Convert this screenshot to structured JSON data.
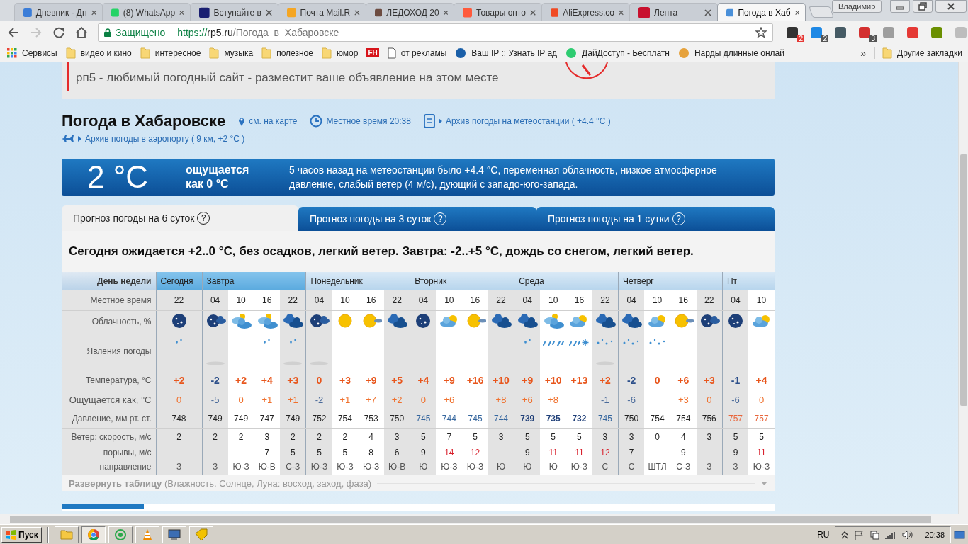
{
  "browser": {
    "tabs": [
      {
        "title": "Дневник - Дн",
        "color": "#3b7dd8",
        "selected": false
      },
      {
        "title": "(8) WhatsApp",
        "color": "#25d366",
        "selected": false
      },
      {
        "title": "Вступайте в",
        "color": "#1a1f71",
        "selected": false
      },
      {
        "title": "Почта Mail.R",
        "color": "#f5a623",
        "selected": false
      },
      {
        "title": "ЛЕДОХОД 20",
        "color": "#6d4c41",
        "selected": false
      },
      {
        "title": "Товары опто",
        "color": "#ff5a3c",
        "selected": false
      },
      {
        "title": "AliExpress.co",
        "color": "#f04a23",
        "selected": false
      },
      {
        "title": "Лента",
        "color": "#c8102e",
        "selected": false
      },
      {
        "title": "Погода в Хаб",
        "color": "#4a90d9",
        "selected": true
      }
    ],
    "profile": "Владимир",
    "forward_disabled": true,
    "secure_label": "Защищено",
    "url": {
      "scheme": "https://",
      "host": "rp5.ru",
      "path": "/Погода_в_Хабаровске"
    },
    "extensions": [
      {
        "color": "#333333",
        "badge": "2"
      },
      {
        "color": "#1e88e5",
        "badge": "2"
      },
      {
        "color": "#455a64"
      },
      {
        "color": "#d32f2f",
        "badge": "3"
      },
      {
        "color": "#9e9e9e"
      },
      {
        "color": "#e53935"
      },
      {
        "color": "#6a8f00"
      },
      {
        "color": "#bdbdbd"
      }
    ],
    "bookmarks": [
      {
        "kind": "apps",
        "label": "Сервисы"
      },
      {
        "kind": "folder",
        "label": "видео и кино"
      },
      {
        "kind": "folder",
        "label": "интересное"
      },
      {
        "kind": "folder",
        "label": "музыка"
      },
      {
        "kind": "folder",
        "label": "полезное"
      },
      {
        "kind": "folder",
        "label": "юмор"
      },
      {
        "kind": "logo",
        "logo": "FH"
      },
      {
        "kind": "page",
        "label": "от рекламы"
      },
      {
        "kind": "site",
        "label": "Ваш IP :: Узнать IP ад",
        "color": "#1a5fa8"
      },
      {
        "kind": "site",
        "label": "ДайДоступ - Бесплатн",
        "color": "#2ecc71"
      },
      {
        "kind": "site",
        "label": "Нарды длинные онлай",
        "color": "#e6a23c"
      }
    ],
    "more": "»",
    "other_bookmarks": "Другие закладки"
  },
  "page": {
    "ad": "рп5 - любимый погодный сайт - разместит ваше объявление на этом месте",
    "title": "Погода в Хабаровске",
    "map_link": "см. на карте",
    "local_time": "Местное время  20:38",
    "archive_station": "Архив погоды на метеостанции ( +4.4 °C )",
    "archive_airport": "Архив погоды в аэропорту ( 9 км, +2 °C )",
    "current": {
      "temperature": "2 °C",
      "feels": "ощущается как 0 °C",
      "description": "5 часов назад на метеостанции было +4.4 °C, переменная облачность, низкое атмосферное давление, слабый ветер (4 м/с), дующий с западо-юго-запада."
    },
    "forecast_tabs": [
      {
        "label": "Прогноз погоды на 6 суток",
        "help": "?",
        "selected": true
      },
      {
        "label": "Прогноз погоды на 3 суток",
        "help": "?",
        "selected": false
      },
      {
        "label": "Прогноз погоды на 1 сутки",
        "help": "?",
        "selected": false
      }
    ],
    "summary": "Сегодня ожидается +2..0 °C, без осадков, легкий ветер. Завтра: -2..+5 °C, дождь со снегом, легкий ветер.",
    "table": {
      "row_labels": [
        "День недели",
        "Местное время",
        "Облачность, %",
        "Явления погоды",
        "Температура, °C",
        "Ощущается как, °C",
        "Давление, мм рт. ст.",
        "Ветер: скорость, м/с",
        "порывы, м/с",
        "направление"
      ],
      "days": [
        {
          "name": "Сегодня",
          "highlight": true,
          "columns": [
            {
              "time": "22",
              "night": true,
              "sky": {
                "kind": "night-clear"
              },
              "precip": {
                "kind": "drizzle"
              },
              "fog": false,
              "temp": {
                "value": "+2",
                "kind": "warm"
              },
              "feels": {
                "value": "0",
                "kind": "warm"
              },
              "pressure": {
                "value": "748",
                "kind": "normal"
              },
              "wind": "2",
              "dir": "З"
            }
          ]
        },
        {
          "name": "Завтра",
          "highlight": true,
          "columns": [
            {
              "time": "04",
              "night": true,
              "sky": {
                "kind": "night-partly"
              },
              "fog": true,
              "temp": {
                "value": "-2",
                "kind": "cold"
              },
              "feels": {
                "value": "-5",
                "kind": "cold"
              },
              "pressure": {
                "value": "749",
                "kind": "normal"
              },
              "wind": "2",
              "dir": "З"
            },
            {
              "time": "10",
              "night": false,
              "sky": {
                "kind": "cloudy-sun"
              },
              "fog": false,
              "temp": {
                "value": "+2",
                "kind": "warm"
              },
              "feels": {
                "value": "0",
                "kind": "warm"
              },
              "pressure": {
                "value": "749",
                "kind": "normal"
              },
              "wind": "2",
              "dir": "Ю-З"
            },
            {
              "time": "16",
              "night": false,
              "sky": {
                "kind": "cloudy-sun"
              },
              "precip": {
                "kind": "drizzle"
              },
              "fog": false,
              "temp": {
                "value": "+4",
                "kind": "warm"
              },
              "feels": {
                "value": "+1",
                "kind": "warm"
              },
              "pressure": {
                "value": "747",
                "kind": "normal"
              },
              "wind": "3",
              "gust": {
                "value": "7",
                "strong": false
              },
              "dir": "Ю-В"
            },
            {
              "time": "22",
              "night": true,
              "sky": {
                "kind": "overcast"
              },
              "precip": {
                "kind": "drizzle"
              },
              "fog": true,
              "temp": {
                "value": "+3",
                "kind": "warm"
              },
              "feels": {
                "value": "+1",
                "kind": "warm"
              },
              "pressure": {
                "value": "749",
                "kind": "normal"
              },
              "wind": "2",
              "gust": {
                "value": "5",
                "strong": false
              },
              "dir": "С-З"
            }
          ]
        },
        {
          "name": "Понедельник",
          "highlight": false,
          "columns": [
            {
              "time": "04",
              "night": true,
              "sky": {
                "kind": "night-partly"
              },
              "fog": true,
              "temp": {
                "value": "0",
                "kind": "warm"
              },
              "feels": {
                "value": "-2",
                "kind": "cold"
              },
              "pressure": {
                "value": "752",
                "kind": "normal"
              },
              "wind": "2",
              "gust": {
                "value": "5",
                "strong": false
              },
              "dir": "Ю-З"
            },
            {
              "time": "10",
              "night": false,
              "sky": {
                "kind": "sun"
              },
              "fog": false,
              "temp": {
                "value": "+3",
                "kind": "warm"
              },
              "feels": {
                "value": "+1",
                "kind": "warm"
              },
              "pressure": {
                "value": "754",
                "kind": "normal"
              },
              "wind": "2",
              "gust": {
                "value": "5",
                "strong": false
              },
              "dir": "Ю-З"
            },
            {
              "time": "16",
              "night": false,
              "sky": {
                "kind": "sun-cloud"
              },
              "fog": false,
              "temp": {
                "value": "+9",
                "kind": "warm"
              },
              "feels": {
                "value": "+7",
                "kind": "warm"
              },
              "pressure": {
                "value": "753",
                "kind": "normal"
              },
              "wind": "4",
              "gust": {
                "value": "8",
                "strong": false
              },
              "dir": "Ю-З"
            },
            {
              "time": "22",
              "night": true,
              "sky": {
                "kind": "overcast"
              },
              "fog": false,
              "temp": {
                "value": "+5",
                "kind": "warm"
              },
              "feels": {
                "value": "+2",
                "kind": "warm"
              },
              "pressure": {
                "value": "750",
                "kind": "normal"
              },
              "wind": "3",
              "gust": {
                "value": "6",
                "strong": false
              },
              "dir": "Ю-В"
            }
          ]
        },
        {
          "name": "Вторник",
          "highlight": false,
          "columns": [
            {
              "time": "04",
              "night": true,
              "sky": {
                "kind": "night-clear"
              },
              "fog": false,
              "temp": {
                "value": "+4",
                "kind": "warm"
              },
              "feels": {
                "value": "0",
                "kind": "warm"
              },
              "pressure": {
                "value": "745",
                "kind": "low"
              },
              "wind": "5",
              "gust": {
                "value": "9",
                "strong": false
              },
              "dir": "Ю"
            },
            {
              "time": "10",
              "night": false,
              "sky": {
                "kind": "partly-cloudy"
              },
              "fog": false,
              "temp": {
                "value": "+9",
                "kind": "warm"
              },
              "feels": {
                "value": "+6",
                "kind": "warm"
              },
              "pressure": {
                "value": "744",
                "kind": "low"
              },
              "wind": "7",
              "gust": {
                "value": "14",
                "strong": true
              },
              "dir": "Ю-З"
            },
            {
              "time": "16",
              "night": false,
              "sky": {
                "kind": "sun-cloud"
              },
              "fog": false,
              "temp": {
                "value": "+16",
                "kind": "warm"
              },
              "pressure": {
                "value": "745",
                "kind": "low"
              },
              "wind": "5",
              "gust": {
                "value": "12",
                "strong": true
              },
              "dir": "Ю-З"
            },
            {
              "time": "22",
              "night": true,
              "sky": {
                "kind": "overcast"
              },
              "fog": false,
              "temp": {
                "value": "+10",
                "kind": "warm"
              },
              "feels": {
                "value": "+8",
                "kind": "warm"
              },
              "pressure": {
                "value": "744",
                "kind": "low"
              },
              "wind": "3",
              "dir": "Ю"
            }
          ]
        },
        {
          "name": "Среда",
          "highlight": false,
          "columns": [
            {
              "time": "04",
              "night": true,
              "sky": {
                "kind": "overcast"
              },
              "precip": {
                "kind": "drizzle"
              },
              "fog": false,
              "temp": {
                "value": "+9",
                "kind": "warm"
              },
              "feels": {
                "value": "+6",
                "kind": "warm"
              },
              "pressure": {
                "value": "739",
                "kind": "verylow"
              },
              "wind": "5",
              "gust": {
                "value": "9",
                "strong": false
              },
              "dir": "Ю"
            },
            {
              "time": "10",
              "night": false,
              "sky": {
                "kind": "cloudy-sun"
              },
              "precip": {
                "kind": "rain"
              },
              "fog": false,
              "temp": {
                "value": "+10",
                "kind": "warm"
              },
              "feels": {
                "value": "+8",
                "kind": "warm"
              },
              "pressure": {
                "value": "735",
                "kind": "verylow"
              },
              "wind": "5",
              "gust": {
                "value": "11",
                "strong": true
              },
              "dir": "Ю"
            },
            {
              "time": "16",
              "night": false,
              "sky": {
                "kind": "partly-cloudy"
              },
              "precip": {
                "kind": "sleet"
              },
              "fog": false,
              "temp": {
                "value": "+13",
                "kind": "warm"
              },
              "pressure": {
                "value": "732",
                "kind": "verylow"
              },
              "wind": "5",
              "gust": {
                "value": "11",
                "strong": true
              },
              "dir": "Ю-З"
            },
            {
              "time": "22",
              "night": true,
              "sky": {
                "kind": "overcast"
              },
              "precip": {
                "kind": "snow"
              },
              "fog": true,
              "temp": {
                "value": "+2",
                "kind": "warm"
              },
              "feels": {
                "value": "-1",
                "kind": "cold"
              },
              "pressure": {
                "value": "745",
                "kind": "low"
              },
              "wind": "3",
              "gust": {
                "value": "12",
                "strong": true
              },
              "dir": "С"
            }
          ]
        },
        {
          "name": "Четверг",
          "highlight": false,
          "columns": [
            {
              "time": "04",
              "night": true,
              "sky": {
                "kind": "overcast"
              },
              "precip": {
                "kind": "snow"
              },
              "fog": false,
              "temp": {
                "value": "-2",
                "kind": "cold"
              },
              "feels": {
                "value": "-6",
                "kind": "cold"
              },
              "pressure": {
                "value": "750",
                "kind": "normal"
              },
              "wind": "3",
              "gust": {
                "value": "7",
                "strong": false
              },
              "dir": "С"
            },
            {
              "time": "10",
              "night": false,
              "sky": {
                "kind": "partly-cloudy"
              },
              "precip": {
                "kind": "snow"
              },
              "fog": false,
              "temp": {
                "value": "0",
                "kind": "warm"
              },
              "pressure": {
                "value": "754",
                "kind": "normal"
              },
              "wind": "0",
              "dir": "ШТЛ"
            },
            {
              "time": "16",
              "night": false,
              "sky": {
                "kind": "sun-cloud"
              },
              "fog": false,
              "temp": {
                "value": "+6",
                "kind": "warm"
              },
              "feels": {
                "value": "+3",
                "kind": "warm"
              },
              "pressure": {
                "value": "754",
                "kind": "normal"
              },
              "wind": "4",
              "gust": {
                "value": "9",
                "strong": false
              },
              "dir": "С-З"
            },
            {
              "time": "22",
              "night": true,
              "sky": {
                "kind": "night-partly"
              },
              "fog": false,
              "temp": {
                "value": "+3",
                "kind": "warm"
              },
              "feels": {
                "value": "0",
                "kind": "warm"
              },
              "pressure": {
                "value": "756",
                "kind": "normal"
              },
              "wind": "3",
              "dir": "З"
            }
          ]
        },
        {
          "name": "Пт",
          "highlight": false,
          "columns": [
            {
              "time": "04",
              "night": true,
              "sky": {
                "kind": "night-clear"
              },
              "fog": false,
              "temp": {
                "value": "-1",
                "kind": "cold"
              },
              "feels": {
                "value": "-6",
                "kind": "cold"
              },
              "pressure": {
                "value": "757",
                "kind": "high"
              },
              "wind": "5",
              "gust": {
                "value": "9",
                "strong": false
              },
              "dir": "З"
            },
            {
              "time": "10",
              "night": false,
              "sky": {
                "kind": "partly-cloudy"
              },
              "fog": false,
              "temp": {
                "value": "+4",
                "kind": "warm"
              },
              "feels": {
                "value": "0",
                "kind": "warm"
              },
              "pressure": {
                "value": "757",
                "kind": "high"
              },
              "wind": "5",
              "gust": {
                "value": "11",
                "strong": true
              },
              "dir": "Ю-З"
            }
          ]
        }
      ],
      "expand": "**Развернуть таблицу** (Влажность. Солнце, Луна: восход, заход, фаза)"
    }
  },
  "taskbar": {
    "start": "Пуск",
    "apps": [
      {
        "kind": "folder",
        "selected": false
      },
      {
        "kind": "browser",
        "selected": true
      },
      {
        "kind": "messenger",
        "selected": false
      },
      {
        "kind": "cone",
        "selected": false
      },
      {
        "kind": "computer",
        "selected": false
      },
      {
        "kind": "tag",
        "selected": false
      }
    ],
    "language": "RU",
    "clock": "20:38"
  }
}
